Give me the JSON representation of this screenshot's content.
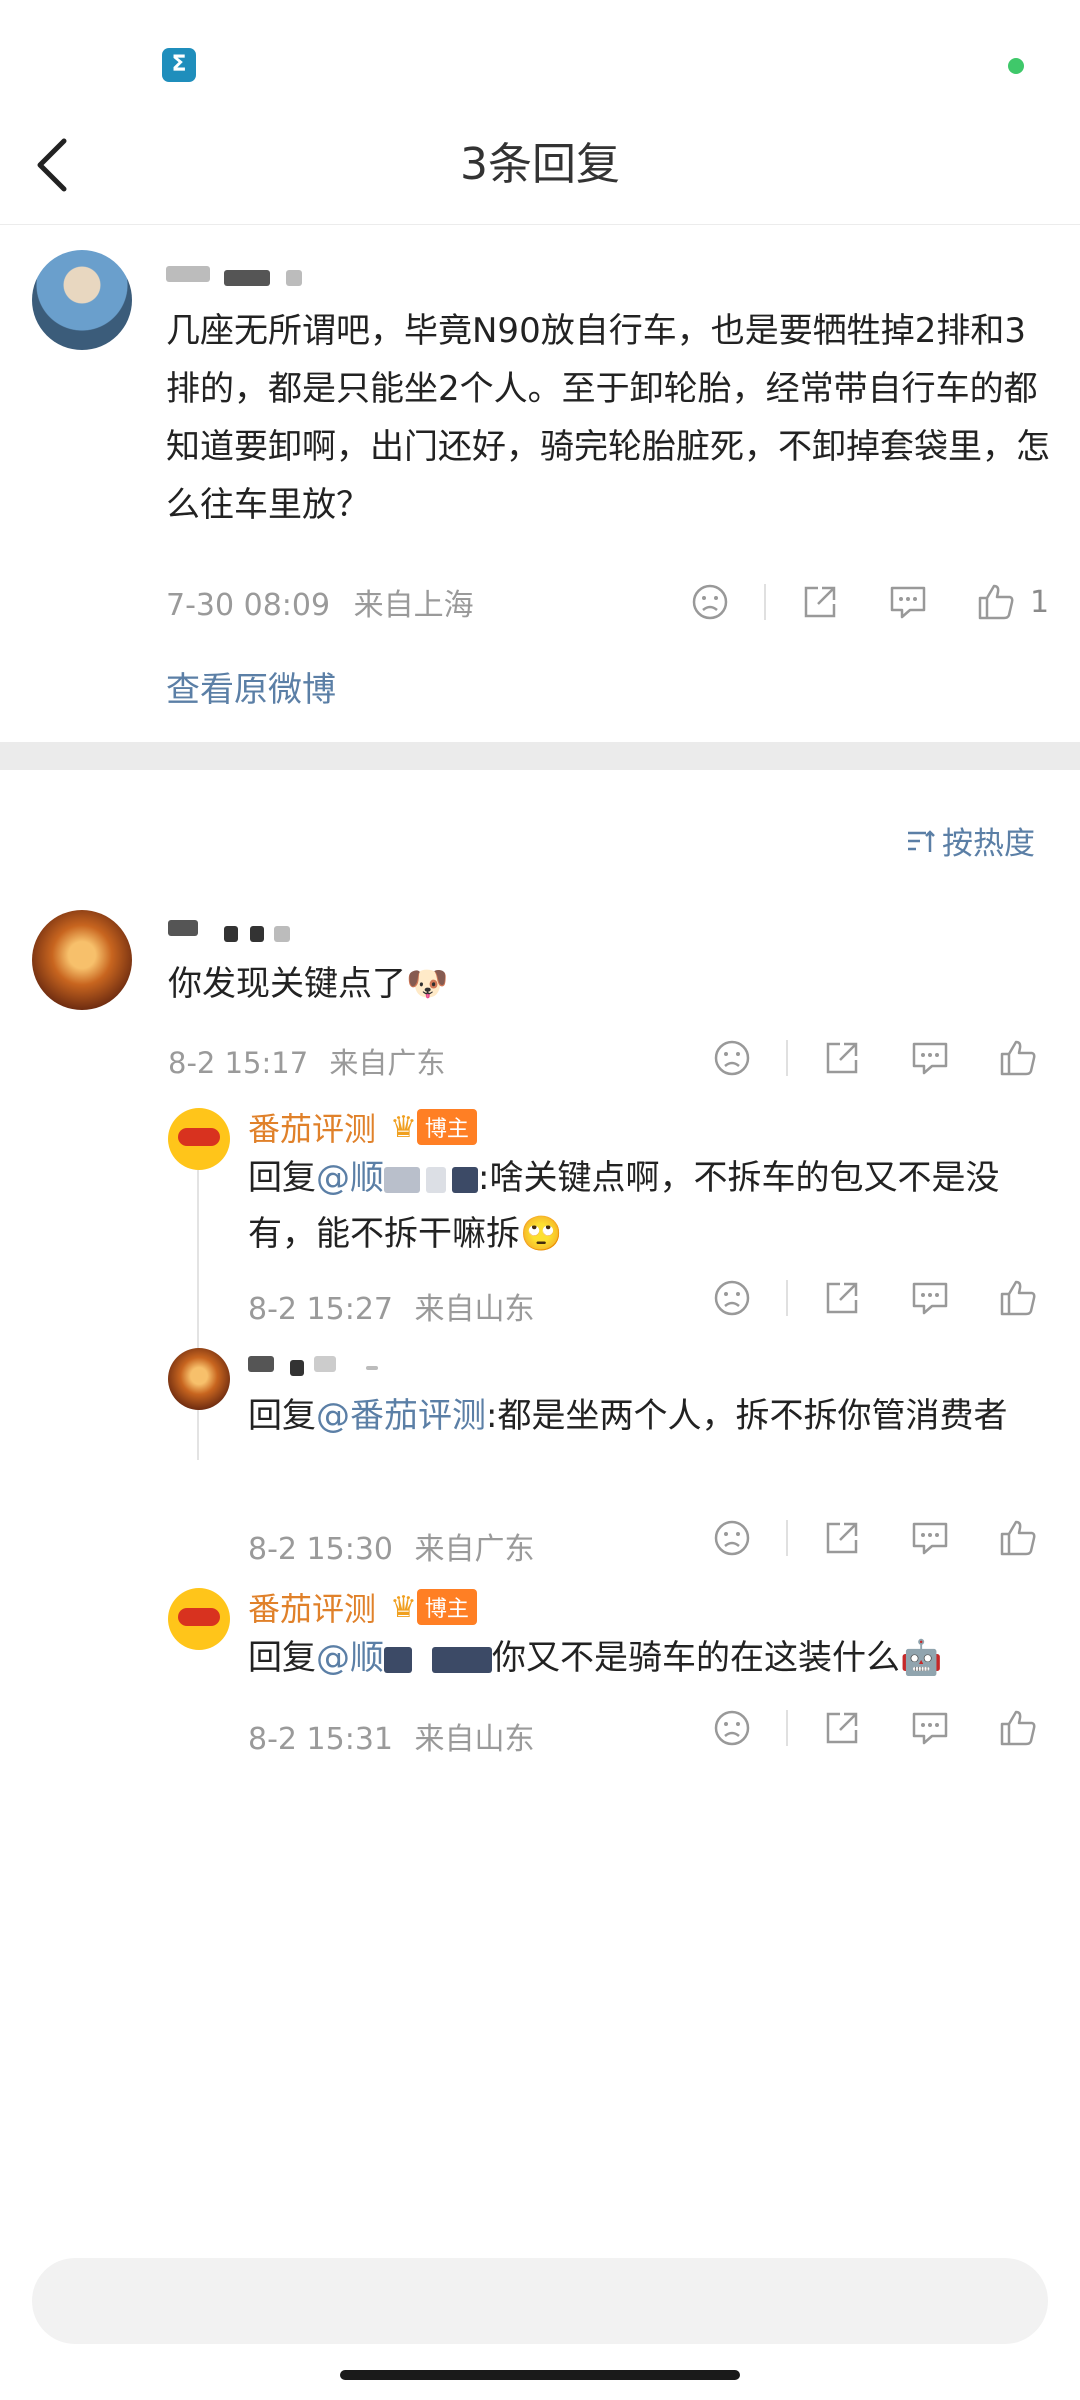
{
  "header": {
    "title": "3条回复"
  },
  "main_post": {
    "text": "几座无所谓吧，毕竟N90放自行车，也是要牺牲掉2排和3排的，都是只能坐2个人。至于卸轮胎，经常带自行车的都知道要卸啊，出门还好，骑完轮胎脏死，不卸掉套袋里，怎么往车里放？",
    "time": "7-30 08:09",
    "location": "来自上海",
    "like_count": "1",
    "view_original": "查看原微博"
  },
  "sort_label": "按热度",
  "comment": {
    "text": "你发现关键点了",
    "emoji": "🐶",
    "time": "8-2 15:17",
    "location": "来自广东"
  },
  "replies": [
    {
      "name": "番茄评测",
      "badge": "博主",
      "prefix": "回复",
      "mention": "@顺",
      "text": ":啥关键点啊，不拆车的包又不是没有，能不拆干嘛拆",
      "emoji": "🙄",
      "time": "8-2 15:27",
      "location": "来自山东"
    },
    {
      "prefix": "回复",
      "mention": "@番茄评测",
      "text": ":都是坐两个人，拆不拆你管消费者",
      "time": "8-2 15:30",
      "location": "来自广东"
    },
    {
      "name": "番茄评测",
      "badge": "博主",
      "prefix": "回复",
      "mention": "@顺",
      "text": "你又不是骑车的在这装什么",
      "emoji": "🤖",
      "time": "8-2 15:31",
      "location": "来自山东"
    }
  ],
  "colors": {
    "link": "#5b7fa6",
    "blogger_name": "#e0812a",
    "badge": "#ff7f24"
  }
}
